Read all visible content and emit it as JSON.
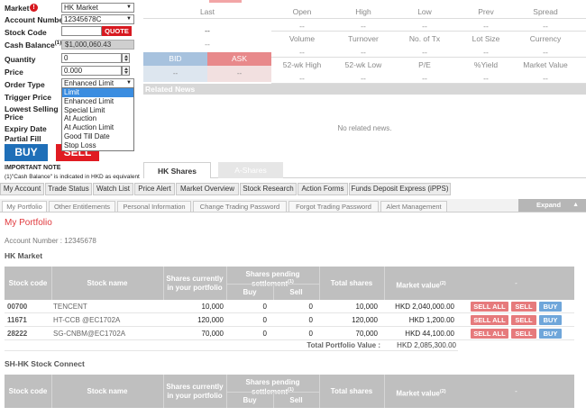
{
  "order_form": {
    "market_label": "Market",
    "market_value": "HK Market",
    "account_label": "Account Number",
    "account_value": "12345678C",
    "stock_code_label": "Stock Code",
    "stock_code_value": "",
    "quote_label": "QUOTE",
    "cash_label": "Cash Balance",
    "cash_sup": "(1)",
    "cash_value": "$1,000,060.43",
    "quantity_label": "Quantity",
    "quantity_value": "0",
    "price_label": "Price",
    "price_value": "0.000",
    "order_type_label": "Order Type",
    "order_type_value": "Enhanced Limit",
    "trigger_label": "Trigger Price",
    "lowest_label_1": "Lowest Selling",
    "lowest_label_2": "Price",
    "expiry_label": "Expiry Date",
    "partial_label": "Partial Fill",
    "order_type_options": [
      "Limit",
      "Enhanced Limit",
      "Special Limit",
      "At Auction",
      "At Auction Limit",
      "Good Till Date",
      "Stop Loss"
    ],
    "buy_label": "BUY",
    "sell_label": "SELL",
    "note_title": "IMPORTANT NOTE",
    "note_text": "(1)\"Cash Balance\" is indicated in HKD as equivalent"
  },
  "quote": {
    "last_label": "Last",
    "last_value": "--",
    "last_sub": "--",
    "row1_labels": [
      "Open",
      "High",
      "Low",
      "Prev",
      "Spread"
    ],
    "row1_values": [
      "--",
      "--",
      "--",
      "--",
      "--"
    ],
    "row2_labels": [
      "Volume",
      "Turnover",
      "No. of Tx",
      "Lot Size",
      "Currency"
    ],
    "row2_values": [
      "--",
      "--",
      "--",
      "--",
      "--"
    ],
    "row3_labels": [
      "52-wk High",
      "52-wk Low",
      "P/E",
      "%Yield",
      "Market Value"
    ],
    "row3_values": [
      "--",
      "--",
      "--",
      "--",
      "--"
    ],
    "bid_label": "BID",
    "ask_label": "ASK",
    "bid_value": "--",
    "ask_value": "--",
    "news_title": "Related News",
    "news_empty": "No related news."
  },
  "market_tabs": [
    "HK Shares",
    "A-Shares"
  ],
  "nav": [
    "My Account",
    "Trade Status",
    "Watch List",
    "Price Alert",
    "Market Overview",
    "Stock Research",
    "Action Forms",
    "Funds Deposit Express (iPPS)"
  ],
  "subnav": [
    "My Portfolio",
    "Other Entitlements",
    "Personal Information",
    "Change Trading Password",
    "Forgot Trading Password",
    "Alert Management"
  ],
  "expand_label": "Expand",
  "portfolio": {
    "title": "My Portfolio",
    "account_line": "Account Number : 12345678",
    "hk_title": "HK Market",
    "sh_title": "SH-HK Stock Connect",
    "headers": {
      "code": "Stock code",
      "name": "Stock name",
      "current_1": "Shares currently",
      "current_2": "in your portfolio",
      "pending_1": "Shares pending",
      "pending_2": "settlement",
      "pending_sup": "(1)",
      "buy": "Buy",
      "sell": "Sell",
      "total": "Total shares",
      "mv": "Market value",
      "mv_sup": "(2)",
      "extra": "-"
    },
    "rows": [
      {
        "code": "00700",
        "name": "TENCENT",
        "current": "10,000",
        "buy": "0",
        "sell": "0",
        "total": "10,000",
        "mv": "HKD 2,040,000.00"
      },
      {
        "code": "11671",
        "name": "HT-CCB @EC1702A",
        "current": "120,000",
        "buy": "0",
        "sell": "0",
        "total": "120,000",
        "mv": "HKD 1,200.00"
      },
      {
        "code": "28222",
        "name": "SG-CNBM@EC1702A",
        "current": "70,000",
        "buy": "0",
        "sell": "0",
        "total": "70,000",
        "mv": "HKD 44,100.00"
      }
    ],
    "row_actions": {
      "sell_all": "SELL ALL",
      "sell": "SELL",
      "buy": "BUY"
    },
    "total_label": "Total Portfolio Value :",
    "total_value": "HKD 2,085,300.00"
  },
  "colors": {
    "accent_red": "#d71920",
    "buy_blue": "#1f6fb8",
    "title_red": "#e03a3e",
    "header_grey": "#bfbfbf"
  }
}
